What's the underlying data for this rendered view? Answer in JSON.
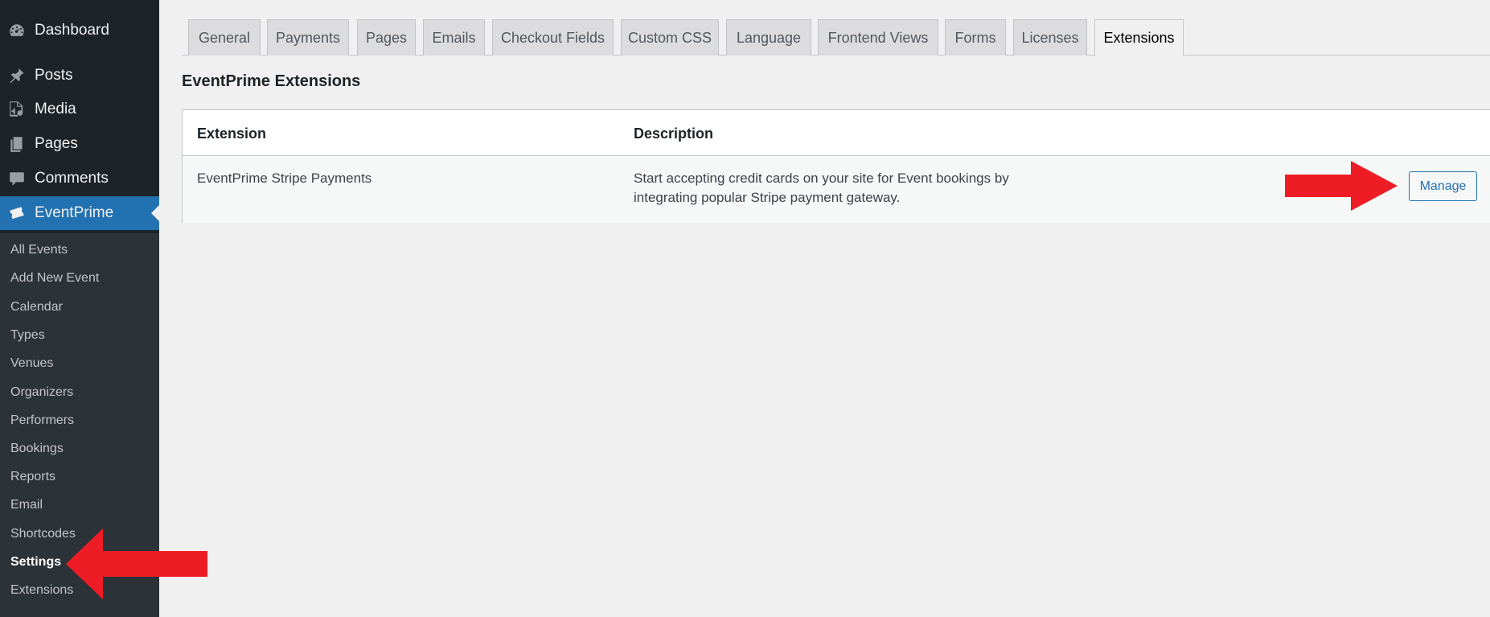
{
  "sidebar": {
    "top_items": [
      {
        "label": "Dashboard",
        "icon": "dashboard-icon"
      },
      {
        "label": "Posts",
        "icon": "pushpin-icon"
      },
      {
        "label": "Media",
        "icon": "media-icon"
      },
      {
        "label": "Pages",
        "icon": "pages-icon"
      },
      {
        "label": "Comments",
        "icon": "comment-bubble-icon"
      },
      {
        "label": "EventPrime",
        "icon": "tickets-icon"
      }
    ],
    "submenu": [
      "All Events",
      "Add New Event",
      "Calendar",
      "Types",
      "Venues",
      "Organizers",
      "Performers",
      "Bookings",
      "Reports",
      "Email",
      "Shortcodes",
      "Settings",
      "Extensions"
    ],
    "current_submenu": "Settings"
  },
  "tabs": [
    "General",
    "Payments",
    "Pages",
    "Emails",
    "Checkout Fields",
    "Custom CSS",
    "Language",
    "Frontend Views",
    "Forms",
    "Licenses",
    "Extensions"
  ],
  "active_tab": "Extensions",
  "page_title": "EventPrime Extensions",
  "table": {
    "headers": {
      "extension": "Extension",
      "description": "Description"
    },
    "rows": [
      {
        "extension": "EventPrime Stripe Payments",
        "description_line1": "Start accepting credit cards on your site for Event bookings by",
        "description_line2": "integrating popular Stripe payment gateway.",
        "action": "Manage"
      }
    ]
  },
  "colors": {
    "sidebar_bg": "#1d2327",
    "submenu_bg": "#2c3338",
    "accent": "#2271b1",
    "annotation_arrow": "#ee1c24",
    "page_bg": "#f0f0f1"
  }
}
